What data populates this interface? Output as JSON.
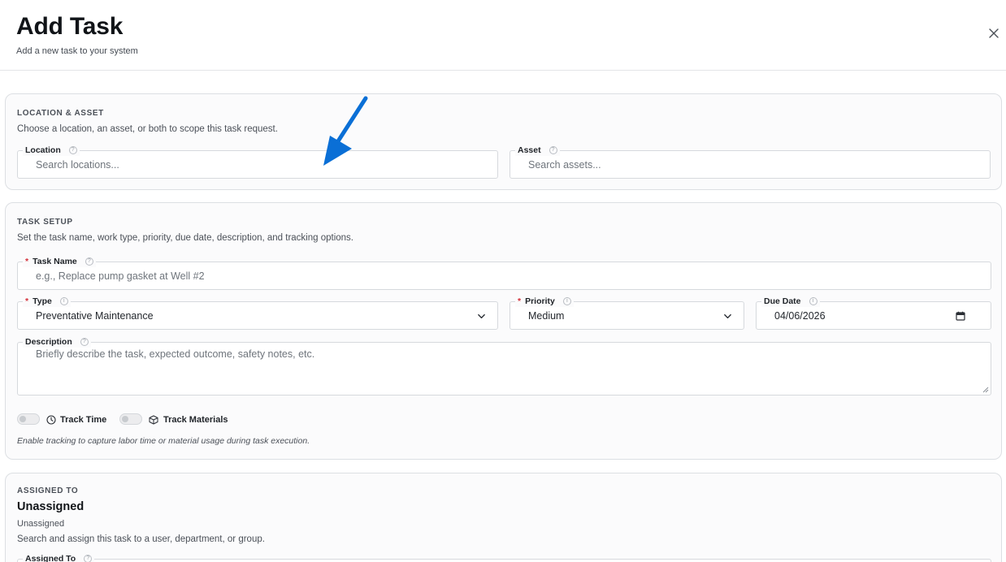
{
  "header": {
    "title": "Add Task",
    "subtitle": "Add a new task to your system"
  },
  "location_asset": {
    "heading": "LOCATION & ASSET",
    "description": "Choose a location, an asset, or both to scope this task request.",
    "location": {
      "label": "Location",
      "placeholder": "Search locations..."
    },
    "asset": {
      "label": "Asset",
      "placeholder": "Search assets..."
    }
  },
  "task_setup": {
    "heading": "TASK SETUP",
    "description": "Set the task name, work type, priority, due date, description, and tracking options.",
    "task_name": {
      "label": "Task Name",
      "placeholder": "e.g., Replace pump gasket at Well #2"
    },
    "type": {
      "label": "Type",
      "value": "Preventative Maintenance"
    },
    "priority": {
      "label": "Priority",
      "value": "Medium"
    },
    "due_date": {
      "label": "Due Date",
      "value": "04/06/2026"
    },
    "description_field": {
      "label": "Description",
      "placeholder": "Briefly describe the task, expected outcome, safety notes, etc."
    },
    "track_time": {
      "label": "Track Time",
      "enabled": false
    },
    "track_materials": {
      "label": "Track Materials",
      "enabled": false
    },
    "tracking_note": "Enable tracking to capture labor time or material usage during task execution."
  },
  "assigned_to": {
    "heading": "ASSIGNED TO",
    "current": "Unassigned",
    "current_sub": "Unassigned",
    "description": "Search and assign this task to a user, department, or group.",
    "field": {
      "label": "Assigned To"
    }
  },
  "icons": {
    "close": "close-icon",
    "help": "help-circle-icon",
    "chevron": "chevron-down-icon",
    "calendar": "calendar-icon",
    "clock": "clock-icon",
    "box": "box-icon",
    "arrow": "arrow-annotation-icon"
  },
  "colors": {
    "required": "#d4303a",
    "annotation_arrow": "#0a6fd6"
  }
}
